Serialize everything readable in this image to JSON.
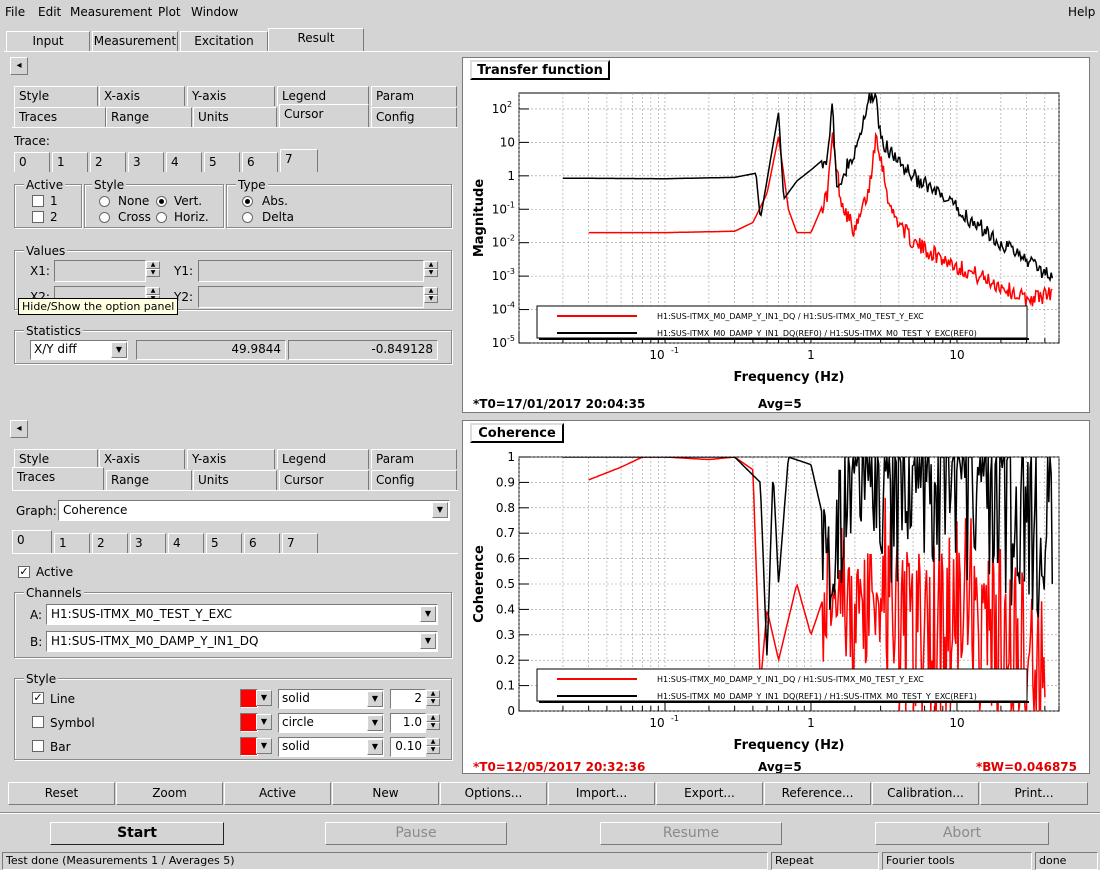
{
  "menu": [
    "File",
    "Edit",
    "Measurement",
    "Plot",
    "Window"
  ],
  "help": "Help",
  "main_tabs": [
    "Input",
    "Measurement",
    "Excitation",
    "Result"
  ],
  "panel_top": {
    "collapse": "◂",
    "subtabs_row1": [
      "Style",
      "X-axis",
      "Y-axis",
      "Legend",
      "Param"
    ],
    "subtabs_row2": [
      "Traces",
      "Range",
      "Units",
      "Cursor",
      "Config"
    ],
    "trace_label": "Trace:",
    "trace_tabs": [
      "0",
      "1",
      "2",
      "3",
      "4",
      "5",
      "6",
      "7"
    ],
    "active_group": "Active",
    "active_opts": [
      "1",
      "2"
    ],
    "style_group": "Style",
    "style_opts": [
      "None",
      "Vert.",
      "Cross",
      "Horiz."
    ],
    "type_group": "Type",
    "type_opts": [
      "Abs.",
      "Delta"
    ],
    "values_group": "Values",
    "x1": "X1:",
    "y1": "Y1:",
    "x2": "X2:",
    "y2": "Y2:",
    "tooltip": "Hide/Show the option panel",
    "stats_group": "Statistics",
    "stats_select": "X/Y diff",
    "stats_val1": "49.9844",
    "stats_val2": "-0.849128"
  },
  "panel_bottom": {
    "collapse": "◂",
    "subtabs_row1": [
      "Style",
      "X-axis",
      "Y-axis",
      "Legend",
      "Param"
    ],
    "subtabs_row2": [
      "Traces",
      "Range",
      "Units",
      "Cursor",
      "Config"
    ],
    "graph_label": "Graph:",
    "graph_value": "Coherence",
    "trace_tabs": [
      "0",
      "1",
      "2",
      "3",
      "4",
      "5",
      "6",
      "7"
    ],
    "active_label": "Active",
    "channels_group": "Channels",
    "chan_a_label": "A:",
    "chan_a": "H1:SUS-ITMX_M0_TEST_Y_EXC",
    "chan_b_label": "B:",
    "chan_b": "H1:SUS-ITMX_M0_DAMP_Y_IN1_DQ",
    "style_group": "Style",
    "rows": [
      {
        "label": "Line",
        "checked": true,
        "pattern": "solid",
        "num": "2"
      },
      {
        "label": "Symbol",
        "checked": false,
        "pattern": "circle",
        "num": "1.0"
      },
      {
        "label": "Bar",
        "checked": false,
        "pattern": "solid",
        "num": "0.10"
      }
    ],
    "swatch_color": "#ff0000"
  },
  "bottom_buttons": [
    "Reset",
    "Zoom",
    "Active",
    "New",
    "Options...",
    "Import...",
    "Export...",
    "Reference...",
    "Calibration...",
    "Print..."
  ],
  "control_buttons": [
    "Start",
    "Pause",
    "Resume",
    "Abort"
  ],
  "statusbar": [
    "Test done (Measurements 1 / Averages 5)",
    "Repeat",
    "Fourier tools",
    "done"
  ],
  "plot1": {
    "title": "Transfer function",
    "footer_left": "*T0=17/01/2017 20:04:35",
    "footer_mid": "Avg=5"
  },
  "plot2": {
    "title": "Coherence",
    "footer_left": "*T0=12/05/2017 20:32:36",
    "footer_mid": "Avg=5",
    "footer_right": "*BW=0.046875"
  },
  "chart_data": [
    {
      "type": "line",
      "title": "Transfer function",
      "xlabel": "Frequency (Hz)",
      "ylabel": "Magnitude",
      "xscale": "log",
      "yscale": "log",
      "xlim": [
        0.01,
        50
      ],
      "ylim": [
        1e-05,
        300
      ],
      "x_ticks": [
        "10^-1",
        "1",
        "10"
      ],
      "y_ticks": [
        "10^-5",
        "10^-4",
        "10^-3",
        "10^-2",
        "10^-1",
        "1",
        "10",
        "10^2"
      ],
      "grid": true,
      "legend_position": "bottom-right",
      "series": [
        {
          "name": "H1:SUS-ITMX_M0_DAMP_Y_IN1_DQ / H1:SUS-ITMX_M0_TEST_Y_EXC",
          "color": "#ff0000",
          "x": [
            0.03,
            0.1,
            0.3,
            0.4,
            0.5,
            0.6,
            0.7,
            0.8,
            1.0,
            1.3,
            1.4,
            1.6,
            2.0,
            2.5,
            2.8,
            3.5,
            5,
            10,
            20,
            30,
            45
          ],
          "y": [
            0.02,
            0.02,
            0.022,
            0.04,
            0.3,
            15,
            0.1,
            0.02,
            0.02,
            0.3,
            15,
            0.2,
            0.02,
            0.4,
            20,
            0.1,
            0.01,
            0.002,
            0.0005,
            0.0002,
            0.0003
          ]
        },
        {
          "name": "H1:SUS-ITMX_M0_DAMP_Y_IN1_DQ(REF0) / H1:SUS-ITMX_M0_TEST_Y_EXC(REF0)",
          "color": "#000000",
          "x": [
            0.02,
            0.1,
            0.3,
            0.42,
            0.45,
            0.6,
            0.65,
            0.8,
            1.0,
            1.3,
            1.4,
            1.5,
            1.7,
            2.0,
            2.5,
            2.8,
            3.0,
            5,
            10,
            20,
            30,
            45
          ],
          "y": [
            0.85,
            0.82,
            0.9,
            1.2,
            0.05,
            80,
            0.2,
            0.7,
            1.5,
            4,
            150,
            0.3,
            1.5,
            4,
            200,
            300,
            10,
            1,
            0.1,
            0.01,
            0.003,
            0.001
          ]
        }
      ]
    },
    {
      "type": "line",
      "title": "Coherence",
      "xlabel": "Frequency (Hz)",
      "ylabel": "Coherence",
      "xscale": "log",
      "xlim": [
        0.01,
        50
      ],
      "ylim": [
        0,
        1
      ],
      "x_ticks": [
        "10^-1",
        "1",
        "10"
      ],
      "y_ticks": [
        "0",
        "0.1",
        "0.2",
        "0.3",
        "0.4",
        "0.5",
        "0.6",
        "0.7",
        "0.8",
        "0.9",
        "1"
      ],
      "grid": true,
      "legend_position": "bottom-right",
      "series": [
        {
          "name": "H1:SUS-ITMX_M0_DAMP_Y_IN1_DQ / H1:SUS-ITMX_M0_TEST_Y_EXC",
          "color": "#ff0000",
          "x": [
            0.03,
            0.05,
            0.07,
            0.1,
            0.2,
            0.3,
            0.4,
            0.45,
            0.5,
            0.6,
            0.8,
            1.0,
            1.5,
            2,
            3,
            5,
            10,
            20,
            40
          ],
          "y": [
            0.91,
            0.96,
            1.0,
            1.0,
            0.99,
            1.0,
            0.95,
            0.1,
            0.4,
            0.2,
            0.5,
            0.3,
            0.6,
            0.3,
            0.5,
            0.2,
            0.4,
            0.2,
            0.1
          ]
        },
        {
          "name": "H1:SUS-ITMX_M0_DAMP_Y_IN1_DQ(REF1) / H1:SUS-ITMX_M0_TEST_Y_EXC(REF1)",
          "color": "#000000",
          "x": [
            0.02,
            0.1,
            0.3,
            0.45,
            0.5,
            0.55,
            0.6,
            0.7,
            1.0,
            1.4,
            2,
            3,
            5,
            10,
            20,
            30,
            45
          ],
          "y": [
            1.0,
            1.0,
            1.0,
            0.9,
            0.2,
            0.95,
            0.5,
            1.0,
            0.97,
            0.6,
            0.98,
            0.9,
            1.0,
            0.98,
            0.9,
            0.8,
            0.7
          ]
        }
      ]
    }
  ]
}
